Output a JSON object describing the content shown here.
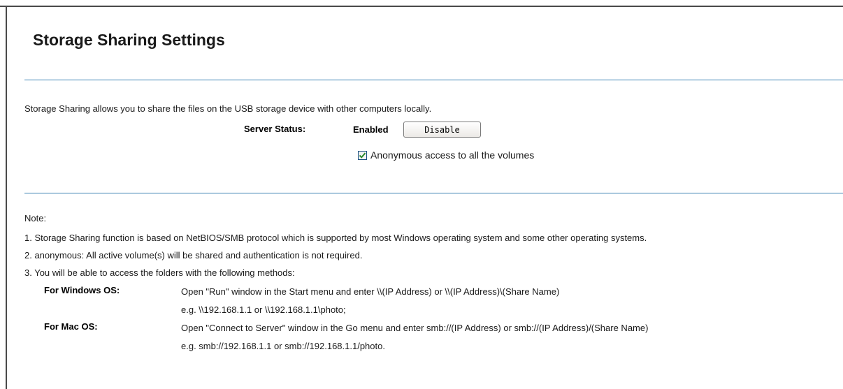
{
  "page": {
    "title": "Storage Sharing Settings",
    "intro": "Storage Sharing allows you to share the files on the USB storage device with other computers locally."
  },
  "server": {
    "status_label": "Server Status:",
    "status_value": "Enabled",
    "disable_button": "Disable"
  },
  "anonymous": {
    "checked": true,
    "label": "Anonymous access to all the volumes"
  },
  "notes": {
    "heading": "Note:",
    "items": [
      "1. Storage Sharing function is based on NetBIOS/SMB protocol which is supported by most Windows operating system and some other operating systems.",
      "2. anonymous: All active volume(s) will be shared and authentication is not required.",
      "3. You will be able to access the folders with the following methods:"
    ],
    "methods": [
      {
        "os_label": "For Windows OS:",
        "line1": "Open \"Run\" window in the Start menu and enter \\\\(IP Address) or \\\\(IP Address)\\(Share Name)",
        "line2": "e.g. \\\\192.168.1.1 or \\\\192.168.1.1\\photo;"
      },
      {
        "os_label": "For Mac OS:",
        "line1": "Open \"Connect to Server\" window in the Go menu and enter smb://(IP Address) or smb://(IP Address)/(Share Name)",
        "line2": "e.g. smb://192.168.1.1 or smb://192.168.1.1/photo."
      }
    ]
  },
  "colors": {
    "rule": "#3b80b3",
    "frame": "#4a4a4a",
    "checkmark": "#2e8b2e"
  }
}
